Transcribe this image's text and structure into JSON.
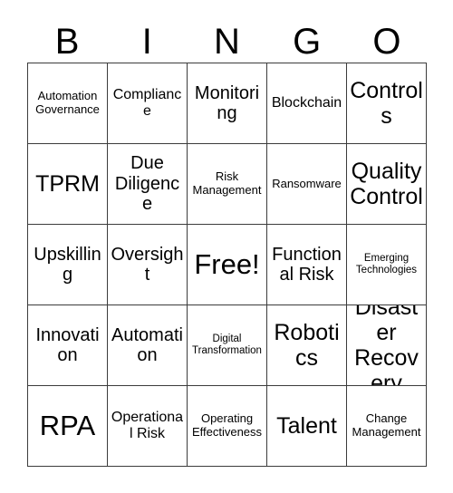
{
  "card": {
    "title": "BINGO",
    "columns": [
      "B",
      "I",
      "N",
      "G",
      "O"
    ],
    "free_space_label": "Free!",
    "colors": {
      "background": "#ffffff",
      "text": "#000000",
      "grid_line": "#3c3c3c"
    },
    "rows": [
      [
        {
          "label": "Automation Governance",
          "size": "sm"
        },
        {
          "label": "Compliance",
          "size": "md"
        },
        {
          "label": "Monitoring",
          "size": "lg"
        },
        {
          "label": "Blockchain",
          "size": "md"
        },
        {
          "label": "Controls",
          "size": "xl"
        }
      ],
      [
        {
          "label": "TPRM",
          "size": "xl"
        },
        {
          "label": "Due Diligence",
          "size": "lg"
        },
        {
          "label": "Risk Management",
          "size": "sm"
        },
        {
          "label": "Ransomware",
          "size": "sm"
        },
        {
          "label": "Quality Control",
          "size": "xl"
        }
      ],
      [
        {
          "label": "Upskilling",
          "size": "lg"
        },
        {
          "label": "Oversight",
          "size": "lg"
        },
        {
          "label": "Free!",
          "size": "xxl"
        },
        {
          "label": "Functional Risk",
          "size": "lg"
        },
        {
          "label": "Emerging Technologies",
          "size": "xs"
        }
      ],
      [
        {
          "label": "Innovation",
          "size": "lg"
        },
        {
          "label": "Automation",
          "size": "lg"
        },
        {
          "label": "Digital Transformation",
          "size": "xs"
        },
        {
          "label": "Robotics",
          "size": "xl"
        },
        {
          "label": "Disaster Recovery",
          "size": "xl"
        }
      ],
      [
        {
          "label": "RPA",
          "size": "xxl"
        },
        {
          "label": "Operational Risk",
          "size": "md"
        },
        {
          "label": "Operating Effectiveness",
          "size": "sm"
        },
        {
          "label": "Talent",
          "size": "xl"
        },
        {
          "label": "Change Management",
          "size": "sm"
        }
      ]
    ]
  }
}
